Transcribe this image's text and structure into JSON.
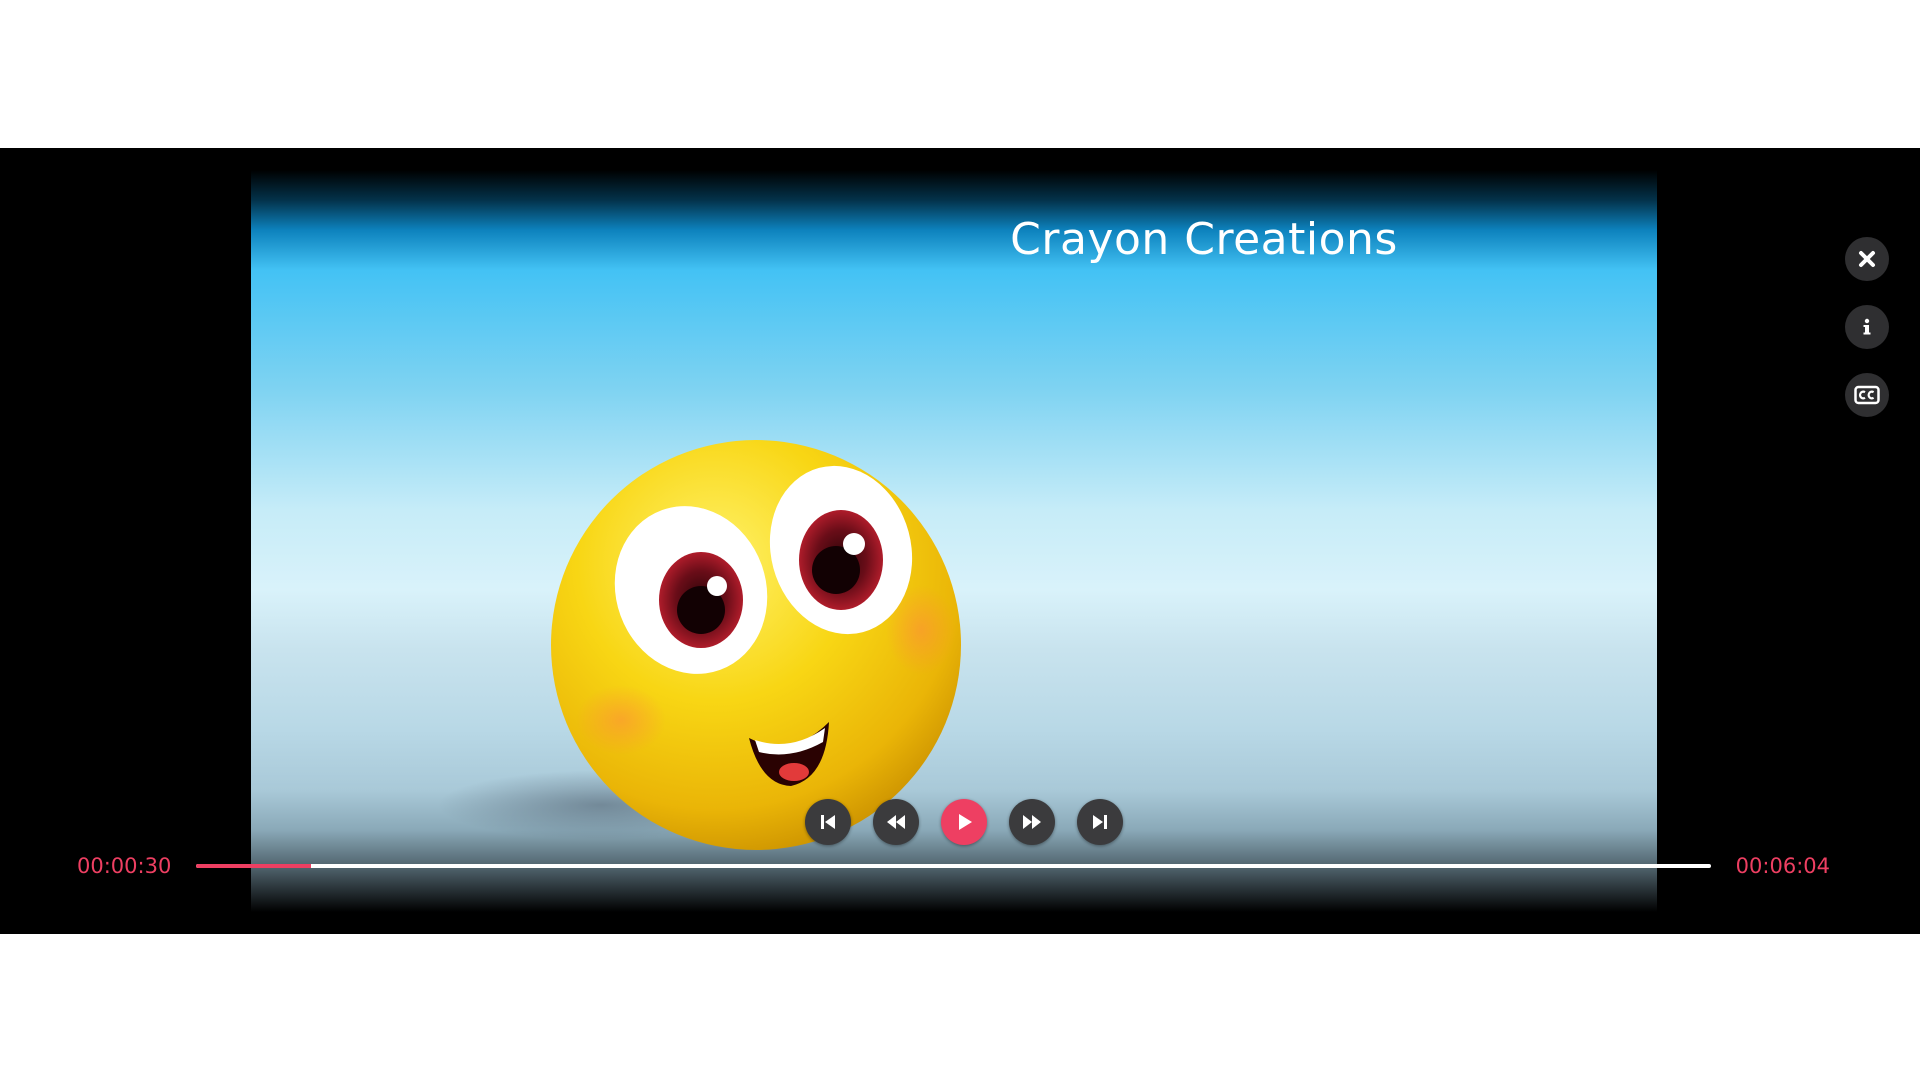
{
  "video": {
    "title": "Crayon Creations"
  },
  "playback": {
    "current_time": "00:00:30",
    "total_time": "00:06:04",
    "progress_fraction": 0.076
  },
  "controls": {
    "skip_back_icon": "skip-previous-icon",
    "rewind_icon": "rewind-icon",
    "play_icon": "play-icon",
    "fast_forward_icon": "fast-forward-icon",
    "skip_next_icon": "skip-next-icon"
  },
  "side_actions": {
    "close_icon": "close-icon",
    "info_icon": "info-icon",
    "captions_icon": "closed-captions-icon"
  },
  "colors": {
    "accent": "#ee3f62",
    "button_bg": "#3b3b3d",
    "progress_track": "#ffffff"
  }
}
